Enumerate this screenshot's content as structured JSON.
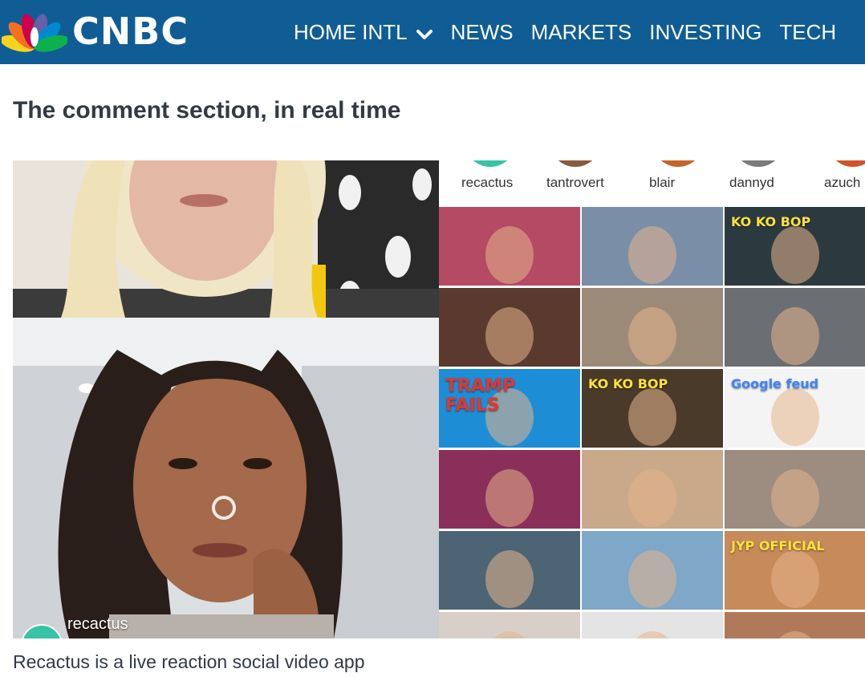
{
  "header": {
    "brand": "CNBC",
    "brand_colors": [
      "#f9d41d",
      "#f37021",
      "#cc004c",
      "#6460aa",
      "#0089d0",
      "#0db14b"
    ],
    "background": "#105d96",
    "nav": [
      {
        "label": "HOME INTL",
        "has_dropdown": true
      },
      {
        "label": "NEWS"
      },
      {
        "label": "MARKETS"
      },
      {
        "label": "INVESTING"
      },
      {
        "label": "TECH"
      }
    ]
  },
  "article": {
    "headline": "The comment section, in real time",
    "caption": "Recactus is a live reaction social video app"
  },
  "media": {
    "main_user_tag": "recactus",
    "users": [
      {
        "name": "recactus",
        "color": "#38c3a6"
      },
      {
        "name": "tantrovert",
        "color": "#8a5a3c"
      },
      {
        "name": "blair",
        "color": "#c2662a"
      },
      {
        "name": "dannyd",
        "color": "#7b7b7b"
      },
      {
        "name": "azuch",
        "color": "#d0542a"
      }
    ],
    "tiles": [
      {
        "text": "",
        "bg": "#b44a63"
      },
      {
        "text": "",
        "bg": "#7a8ea8"
      },
      {
        "text": "KO KO BOP",
        "bg": "#2c3a40"
      },
      {
        "text": "",
        "bg": "#5a3a2e"
      },
      {
        "text": "",
        "bg": "#9b8a78"
      },
      {
        "text": "",
        "bg": "#6a6f74"
      },
      {
        "text": "TRAMP FAILS",
        "bg": "#1d8ed6"
      },
      {
        "text": "KO KO BOP",
        "bg": "#4a3a2a"
      },
      {
        "text": "Google feud",
        "bg": "#f4f4f4"
      },
      {
        "text": "",
        "bg": "#8a2e5a"
      },
      {
        "text": "",
        "bg": "#c9a98a"
      },
      {
        "text": "",
        "bg": "#9c8d80"
      },
      {
        "text": "",
        "bg": "#4d6474"
      },
      {
        "text": "",
        "bg": "#7fa7c7"
      },
      {
        "text": "JYP OFFICIAL",
        "bg": "#c78a5a"
      },
      {
        "text": "",
        "bg": "#d8d0c8"
      },
      {
        "text": "",
        "bg": "#e4e4e4"
      },
      {
        "text": "",
        "bg": "#b07a5a"
      }
    ]
  }
}
